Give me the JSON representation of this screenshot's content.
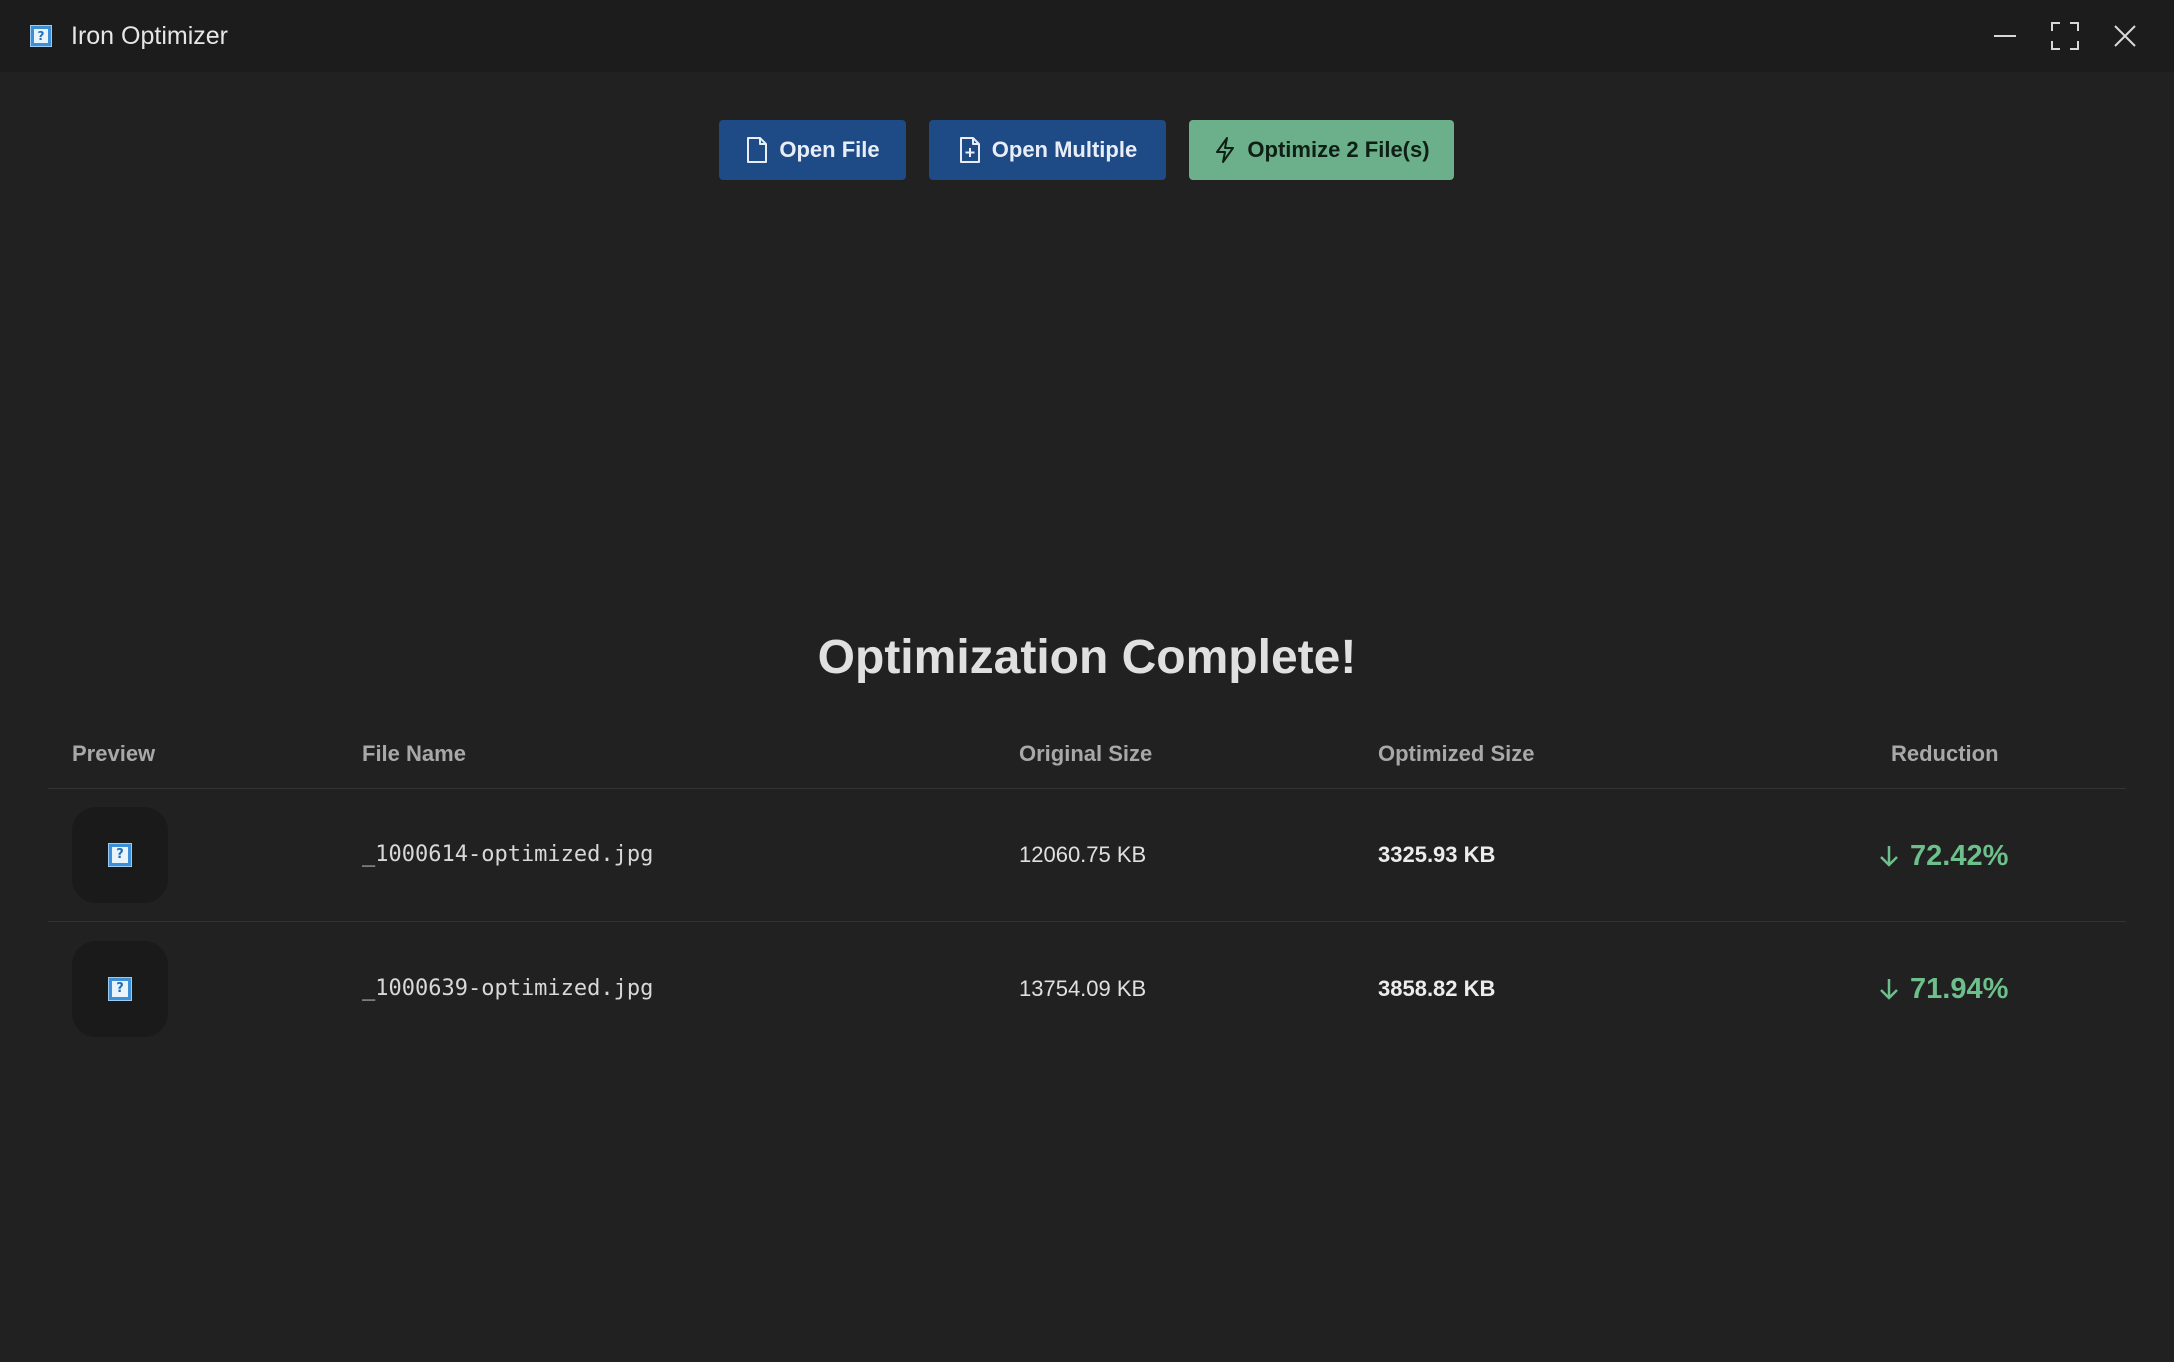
{
  "window": {
    "title": "Iron Optimizer",
    "icon": "app-icon-placeholder",
    "controls": [
      "minimize-icon",
      "maximize-icon",
      "close-icon"
    ]
  },
  "toolbar": {
    "open_file_label": "Open File",
    "open_multiple_label": "Open Multiple",
    "optimize_label": "Optimize 2 File(s)"
  },
  "main": {
    "heading": "Optimization Complete!",
    "columns": {
      "preview": "Preview",
      "file_name": "File Name",
      "original_size": "Original Size",
      "optimized_size": "Optimized Size",
      "reduction": "Reduction"
    },
    "rows": [
      {
        "file_name": "_1000614-optimized.jpg",
        "original_size": "12060.75 KB",
        "optimized_size": "3325.93 KB",
        "reduction": "72.42%"
      },
      {
        "file_name": "_1000639-optimized.jpg",
        "original_size": "13754.09 KB",
        "optimized_size": "3858.82 KB",
        "reduction": "71.94%"
      }
    ]
  },
  "colors": {
    "background": "#212121",
    "titlebar": "#1c1c1c",
    "primary_button": "#1e4a86",
    "success_button": "#6bb08a",
    "reduction_text": "#6dbf8b"
  }
}
